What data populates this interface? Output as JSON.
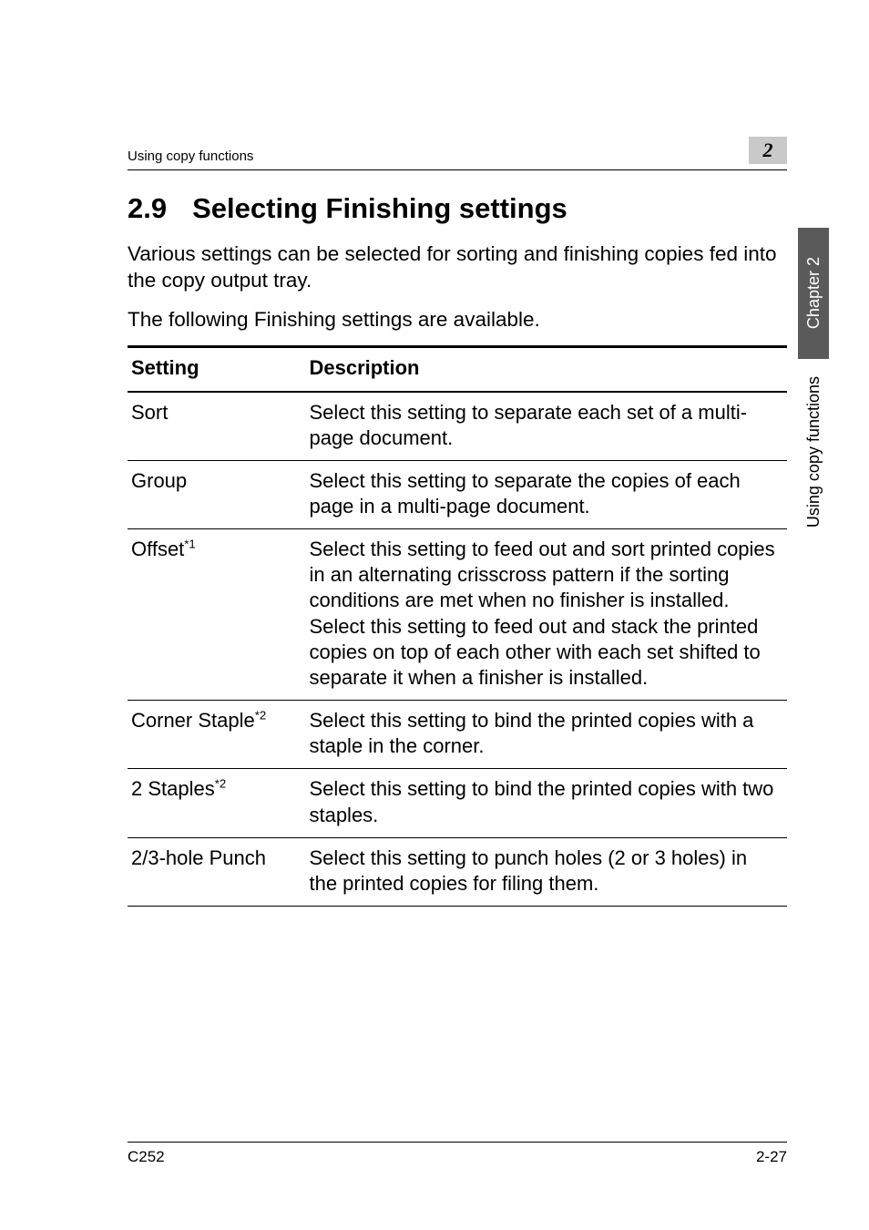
{
  "running_head": {
    "left": "Using copy functions",
    "chapter_badge": "2"
  },
  "section": {
    "number": "2.9",
    "title": "Selecting Finishing settings"
  },
  "paragraphs": {
    "p1": "Various settings can be selected for sorting and finishing copies fed into the copy output tray.",
    "p2": "The following Finishing settings are available."
  },
  "table": {
    "headers": {
      "col1": "Setting",
      "col2": "Description"
    },
    "rows": [
      {
        "setting": "Sort",
        "note": "",
        "description": "Select this setting to separate each set of a multi-page document."
      },
      {
        "setting": "Group",
        "note": "",
        "description": "Select this setting to separate the copies of each page in a multi-page document."
      },
      {
        "setting": "Offset",
        "note": "*1",
        "description": "Select this setting to feed out and sort printed copies in an alternating crisscross pattern if the sorting conditions are met when no finisher is installed.\nSelect this setting to feed out and stack the printed copies on top of each other with each set shifted to separate it when a finisher is installed."
      },
      {
        "setting": "Corner Staple",
        "note": "*2",
        "description": "Select this setting to bind the printed copies with a staple in the corner."
      },
      {
        "setting": "2 Staples",
        "note": "*2",
        "description": "Select this setting to bind the printed copies with two staples."
      },
      {
        "setting": "2/3-hole Punch",
        "note": "",
        "description": "Select this setting to punch holes (2 or 3 holes) in the printed copies for filing them."
      }
    ]
  },
  "side_tabs": {
    "chapter": "Chapter 2",
    "section": "Using copy functions"
  },
  "footer": {
    "left": "C252",
    "right": "2-27"
  }
}
